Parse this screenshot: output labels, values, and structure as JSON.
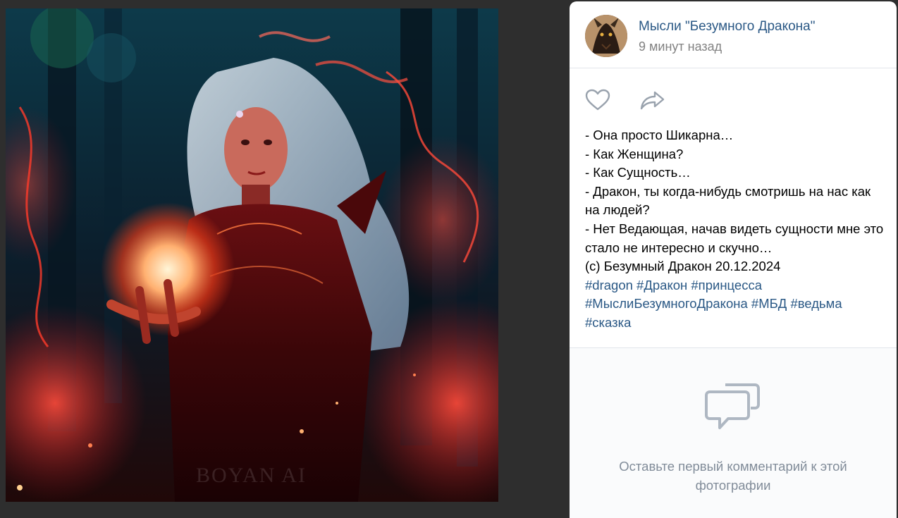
{
  "photo": {
    "watermark": "BOYAN AI"
  },
  "post": {
    "author": "Мысли \"Безумного Дракона\"",
    "time": "9 минут назад",
    "text_lines": [
      "- Она просто Шикарна…",
      "- Как Женщина?",
      "- Как Сущность…",
      "- Дракон, ты когда-нибудь смотришь на нас как на людей?",
      "- Нет Ведающая, начав видеть сущности мне это стало не интересно и скучно…",
      "(с) Безумный Дракон 20.12.2024"
    ],
    "tags": [
      "#dragon",
      "#Дракон",
      "#принцесса",
      "#МыслиБезумногоДракона",
      "#МБД",
      "#ведьма",
      "#сказка"
    ],
    "actions": {
      "like_icon": "heart-icon",
      "share_icon": "share-arrow-icon"
    }
  },
  "comments": {
    "empty_text": "Оставьте первый комментарий к этой фотографии",
    "icon": "comment-bubbles-icon"
  },
  "colors": {
    "link": "#2a5885",
    "muted": "#828282",
    "icon": "#99a2ad",
    "background": "#2e2e2e"
  }
}
